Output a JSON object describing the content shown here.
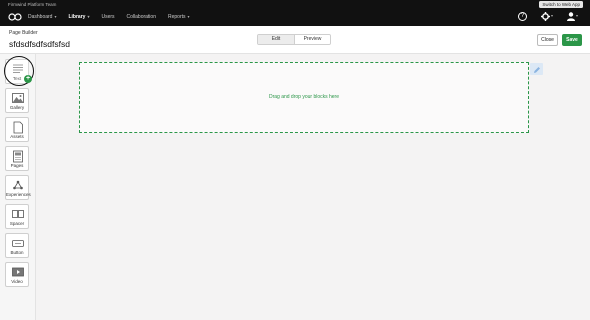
{
  "topbar": {
    "team_name": "Firmwind Platform Team",
    "switch_label": "Switch to Web App",
    "nav": [
      {
        "label": "Dashboard",
        "caret": "▾"
      },
      {
        "label": "Library",
        "caret": "▾"
      },
      {
        "label": "Users",
        "caret": ""
      },
      {
        "label": "Collaboration",
        "caret": ""
      },
      {
        "label": "Reports",
        "caret": "▾"
      }
    ],
    "icons": {
      "help": "?",
      "settings": "✱",
      "user": "👤",
      "caret": "▾"
    }
  },
  "header": {
    "breadcrumb": "Page Builder",
    "title": "sfdsdfsdfsdfsfsd",
    "tabs": [
      "Edit",
      "Preview"
    ],
    "active_tab": "Edit",
    "close_label": "Close",
    "save_label": "Save"
  },
  "sidebar": {
    "tools": [
      {
        "label": "Text",
        "icon": "text-icon"
      },
      {
        "label": "Gallery",
        "icon": "gallery-icon"
      },
      {
        "label": "Assets",
        "icon": "assets-icon"
      },
      {
        "label": "Pages",
        "icon": "pages-icon"
      },
      {
        "label": "Experiences",
        "icon": "experiences-icon"
      },
      {
        "label": "Spacer",
        "icon": "spacer-icon"
      },
      {
        "label": "Button",
        "icon": "button-icon"
      },
      {
        "label": "Video",
        "icon": "video-icon"
      }
    ]
  },
  "canvas": {
    "dropzone_text": "Drag and drop your blocks here"
  },
  "colors": {
    "accent": "#2b9648",
    "topbar": "#111111",
    "edit_chip": "#dce8f5"
  }
}
